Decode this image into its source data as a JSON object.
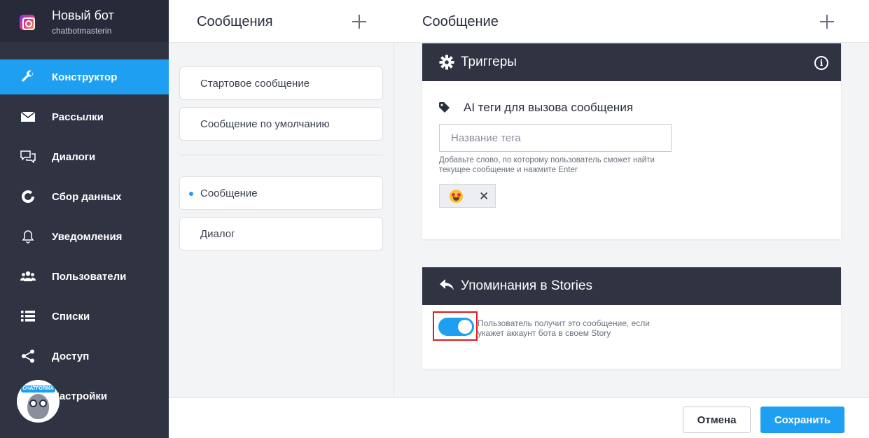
{
  "bot": {
    "name": "Новый бот",
    "account": "chatbotmasterin",
    "icon": "instagram-icon"
  },
  "sidebar": {
    "items": [
      {
        "label": "Конструктор",
        "icon": "wrench-icon",
        "active": true
      },
      {
        "label": "Рассылки",
        "icon": "envelope-icon"
      },
      {
        "label": "Диалоги",
        "icon": "chat-bubbles-icon"
      },
      {
        "label": "Сбор данных",
        "icon": "donut-chart-icon"
      },
      {
        "label": "Уведомления",
        "icon": "bell-icon"
      },
      {
        "label": "Пользователи",
        "icon": "users-icon"
      },
      {
        "label": "Списки",
        "icon": "list-icon"
      },
      {
        "label": "Доступ",
        "icon": "share-icon"
      },
      {
        "label": "Настройки",
        "icon": "gear-icon"
      }
    ],
    "widget_badge": "CHATFORMA"
  },
  "messages_panel": {
    "title": "Сообщения",
    "items": [
      {
        "label": "Стартовое сообщение"
      },
      {
        "label": "Сообщение по умолчанию"
      },
      {
        "label": "Сообщение",
        "selected": true
      },
      {
        "label": "Диалог"
      }
    ]
  },
  "message_panel": {
    "title": "Сообщение",
    "triggers": {
      "title": "Триггеры",
      "ai_tags_label": "AI теги для вызова сообщения",
      "tag_placeholder": "Название тега",
      "hint": "Добавьте слово, по которому пользователь сможет найти текущее сообщение и нажмите Enter",
      "tag_chip_emoji": "heart-eyes-emoji",
      "remove_symbol": "✕"
    },
    "stories": {
      "title": "Упоминания в Stories",
      "toggle_on": true,
      "toggle_text": "Пользователь получит это сообщение, если укажет аккаунт бота в своем Story"
    }
  },
  "footer": {
    "cancel_label": "Отмена",
    "save_label": "Сохранить"
  },
  "colors": {
    "accent": "#1e9ff2",
    "sidebar": "#2f3342",
    "highlight": "#e01b1b"
  }
}
